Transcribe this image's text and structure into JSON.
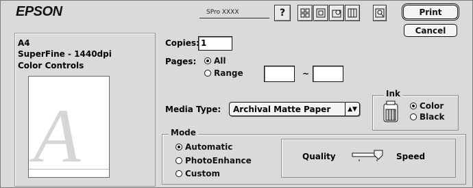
{
  "header": {
    "brand": "EPSON",
    "printer_name": "SPro XXXX",
    "help_label": "?",
    "print_label": "Print",
    "cancel_label": "Cancel"
  },
  "summary": {
    "line1": "A4",
    "line2": "SuperFine - 1440dpi",
    "line3": "Color Controls",
    "preview_letter": "A"
  },
  "copies": {
    "label": "Copies:",
    "value": "1"
  },
  "pages": {
    "label": "Pages:",
    "all": "All",
    "range": "Range",
    "separator": "~",
    "from": "",
    "to": ""
  },
  "media": {
    "label": "Media Type:",
    "value": "Archival Matte Paper"
  },
  "ink": {
    "label": "Ink",
    "color": "Color",
    "black": "Black"
  },
  "mode": {
    "label": "Mode",
    "automatic": "Automatic",
    "photo_enhance": "PhotoEnhance",
    "custom": "Custom"
  },
  "quality": {
    "left_label": "Quality",
    "right_label": "Speed",
    "slider_position": "middle"
  },
  "icons": [
    "help-icon",
    "layout-icon",
    "page-setup-icon",
    "background-print-icon",
    "utility-icon",
    "preview-icon",
    "ink-cartridge-icon"
  ]
}
